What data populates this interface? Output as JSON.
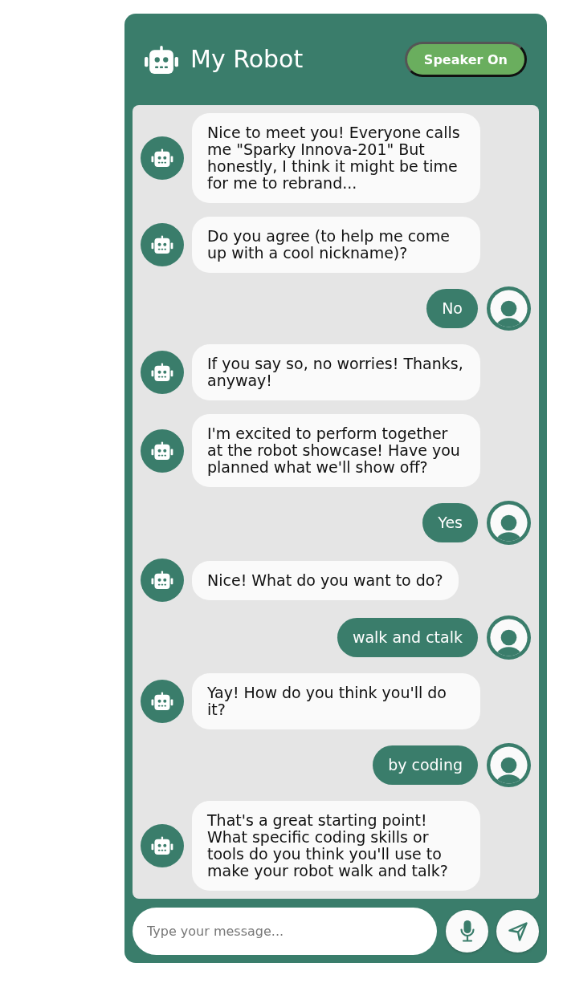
{
  "header": {
    "title": "My Robot",
    "speaker_button": {
      "label": "Speaker On",
      "on": true
    }
  },
  "messages": [
    {
      "kind": "bot",
      "text": "Nice to meet you! Everyone calls me \"Sparky Innova-201\" But honestly, I think it might be time for me to rebrand..."
    },
    {
      "kind": "bot",
      "text": "Do you agree (to help me come up with a cool nickname)?"
    },
    {
      "kind": "user",
      "text": "No"
    },
    {
      "kind": "bot",
      "text": "If you say so, no worries! Thanks, anyway!"
    },
    {
      "kind": "bot",
      "text": "I'm excited to perform together at the robot showcase! Have you planned what we'll show off?"
    },
    {
      "kind": "user",
      "text": "Yes"
    },
    {
      "kind": "bot",
      "text": "Nice! What do you want to do?"
    },
    {
      "kind": "user",
      "text": "walk and ctalk"
    },
    {
      "kind": "bot",
      "text": "Yay! How do you think you'll do it?"
    },
    {
      "kind": "user",
      "text": "by coding"
    },
    {
      "kind": "bot",
      "text": "That's a great starting point! What specific coding skills or tools do you think you'll use to make your robot walk and talk?"
    }
  ],
  "composer": {
    "placeholder": "Type your message..."
  }
}
